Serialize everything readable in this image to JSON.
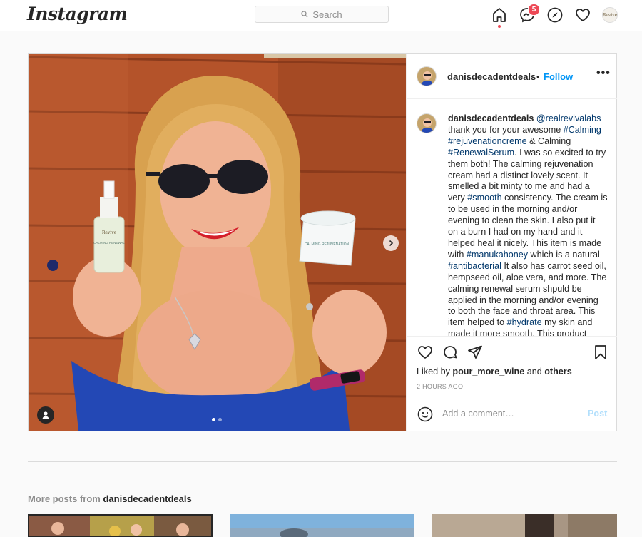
{
  "nav": {
    "logo": "Instagram",
    "search_placeholder": "Search",
    "messages_badge": "5",
    "profile_avatar_text": "Revive"
  },
  "post": {
    "username": "danisdecadentdeals",
    "separator": "•",
    "follow_label": "Follow",
    "more_label": "•••",
    "caption": {
      "username": "danisdecadentdeals",
      "segments": [
        {
          "t": "text",
          "v": " "
        },
        {
          "t": "tag",
          "v": "@realrevivalabs"
        },
        {
          "t": "text",
          "v": " thank you for your awesome "
        },
        {
          "t": "tag",
          "v": "#Calming"
        },
        {
          "t": "text",
          "v": " "
        },
        {
          "t": "tag",
          "v": "#rejuvenationcreme"
        },
        {
          "t": "text",
          "v": " & Calming "
        },
        {
          "t": "tag",
          "v": "#RenewalSerum"
        },
        {
          "t": "text",
          "v": ". I was so excited to try them both!  The calming rejuvenation cream had a distinct lovely scent. It smelled a bit minty to me and had a very "
        },
        {
          "t": "tag",
          "v": "#smooth"
        },
        {
          "t": "text",
          "v": " consistency.  The cream is to be used in the morning and/or evening to clean the skin. I also put it on a burn I had on my hand and it helped heal it nicely. This item is made with "
        },
        {
          "t": "tag",
          "v": "#manukahoney"
        },
        {
          "t": "text",
          "v": " which is a natural "
        },
        {
          "t": "tag",
          "v": "#antibacterial"
        },
        {
          "t": "text",
          "v": " It also has carrot seed oil, hempseed oil, aloe vera, and more. The calming renewal serum shpuld be applied in the morning and/or evening to both the face and throat area. This item helped to "
        },
        {
          "t": "tag",
          "v": "#hydrate"
        },
        {
          "t": "text",
          "v": " my skin and made it more smooth. This product"
        }
      ]
    },
    "liked_by_prefix": "Liked by",
    "liked_by_user": "pour_more_wine",
    "liked_by_and": "and",
    "liked_by_others": "others",
    "timestamp": "2 HOURS AGO",
    "comment_placeholder": "Add a comment…",
    "post_label": "Post",
    "carousel": {
      "count": 2,
      "active": 1
    },
    "product_labels": {
      "bottle_brand": "Revive",
      "bottle_name": "CALMING RENEWAL",
      "jar_name": "CALMING REJUVENATION"
    }
  },
  "more_posts": {
    "prefix": "More posts from",
    "username": "danisdecadentdeals"
  },
  "colors": {
    "accent": "#0095f6",
    "hashtag": "#00376b",
    "badge": "#ed4956",
    "border": "#dbdbdb"
  }
}
